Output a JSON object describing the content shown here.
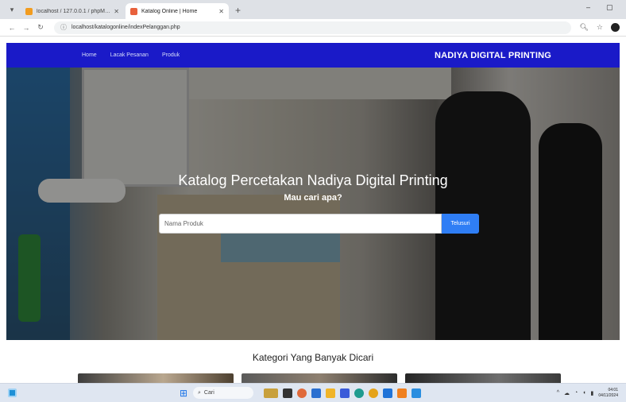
{
  "browser": {
    "tabs": [
      {
        "title": "localhost / 127.0.0.1 / phpMyA"
      },
      {
        "title": "Katalog Online | Home"
      }
    ],
    "url": "localhost/katalogonline/indexPelanggan.php"
  },
  "navbar": {
    "links": [
      "Home",
      "Lacak Pesanan",
      "Produk"
    ],
    "brand": "NADIYA DIGITAL PRINTING"
  },
  "hero": {
    "title": "Katalog Percetakan Nadiya Digital Printing",
    "subtitle": "Mau cari apa?",
    "search_placeholder": "Nama Produk",
    "search_button": "Telusuri"
  },
  "categories": {
    "title": "Kategori Yang Banyak Dicari"
  },
  "taskbar": {
    "search_label": "Cari",
    "time": "04:01",
    "date": "04/11/2024"
  },
  "colors": {
    "navbar": "#1a1ac8",
    "search_button": "#2f7ef5"
  }
}
